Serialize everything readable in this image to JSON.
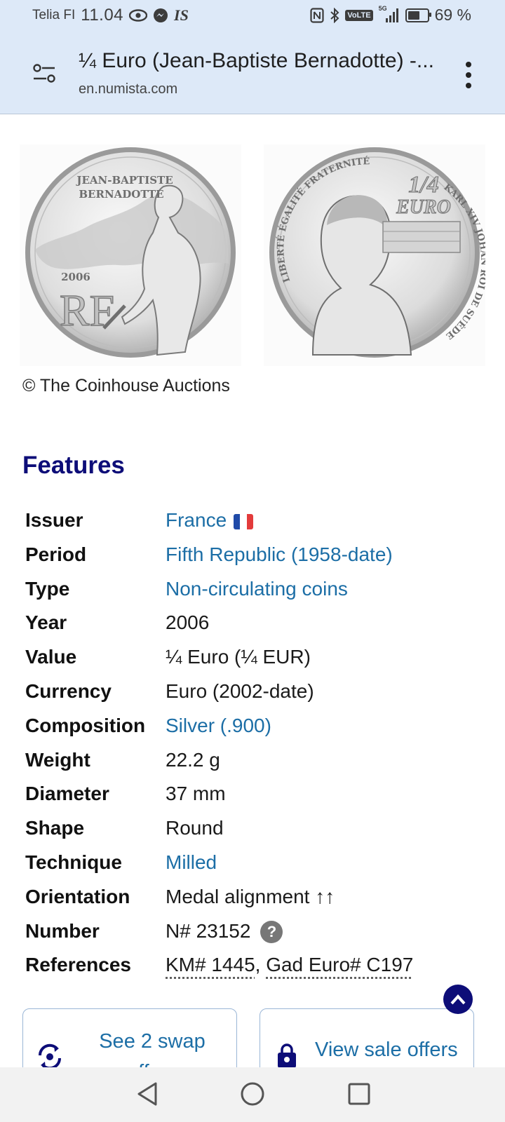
{
  "status_bar": {
    "carrier": "Telia FI",
    "time": "11.04",
    "app_indicator": "IS",
    "network_label": "VoLTE",
    "network_gen": "5G",
    "battery_level": 0.69,
    "battery_pct": "69 %"
  },
  "url_bar": {
    "title": "¼ Euro (Jean-Baptiste Bernadotte) -...",
    "domain": "en.numista.com"
  },
  "images": {
    "credit": "© The Coinhouse Auctions",
    "obverse": {
      "name_line1": "JEAN-BAPTISTE",
      "name_line2": "BERNADOTTE",
      "year": "2006",
      "mark": "RF"
    },
    "reverse": {
      "top_legend": "LIBERTÉ ÉGALITÉ FRATERNITÉ",
      "value_top": "1/4",
      "value_bottom": "EURO",
      "right_legend": "KARL XIV JOHAN ROI DE SUÈDE"
    }
  },
  "features": {
    "heading": "Features",
    "rows": [
      {
        "label": "Issuer",
        "value": "France"
      },
      {
        "label": "Period",
        "value": "Fifth Republic (1958-date)"
      },
      {
        "label": "Type",
        "value": "Non-circulating coins"
      },
      {
        "label": "Year",
        "value": "2006"
      },
      {
        "label": "Value",
        "value": "¼ Euro (¼ EUR)"
      },
      {
        "label": "Currency",
        "value": "Euro (2002-date)"
      },
      {
        "label": "Composition",
        "value": "Silver (.900)"
      },
      {
        "label": "Weight",
        "value": "22.2 g"
      },
      {
        "label": "Diameter",
        "value": "37 mm"
      },
      {
        "label": "Shape",
        "value": "Round"
      },
      {
        "label": "Technique",
        "value": "Milled"
      },
      {
        "label": "Orientation",
        "value": "Medal alignment ↑↑"
      },
      {
        "label": "Number",
        "value": "N# 23152"
      },
      {
        "label": "References",
        "ref1": "KM# 1445",
        "sep": ", ",
        "ref2": "Gad Euro# C197"
      }
    ]
  },
  "actions": {
    "swap_line1": "See 2 swap",
    "swap_line2": "offers",
    "sale_label": "View sale offers"
  },
  "colors": {
    "chrome_bg": "#dde9f8",
    "heading": "#0d0d78",
    "link": "#1c6ea6",
    "flag_blue": "#1f4aa8",
    "flag_red": "#e33b3b"
  }
}
